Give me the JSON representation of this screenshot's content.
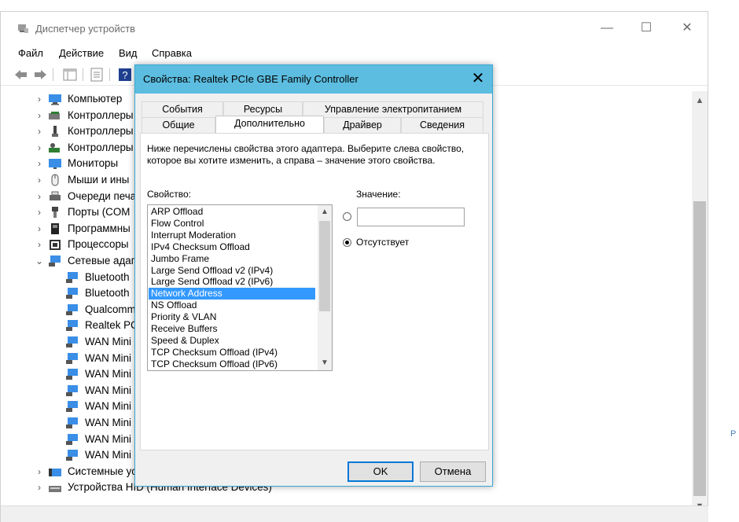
{
  "window": {
    "title": "Диспетчер устройств",
    "controls": {
      "minimize": "—",
      "maximize": "☐",
      "close": "✕"
    }
  },
  "menu": [
    "Файл",
    "Действие",
    "Вид",
    "Справка"
  ],
  "toolbar": {
    "icons": [
      "back-arrow-icon",
      "forward-arrow-icon",
      "console-tree-icon",
      "properties-icon",
      "help-icon"
    ]
  },
  "tree": {
    "top_rows": [
      {
        "label": "Компьютер",
        "icon": "computer-icon"
      },
      {
        "label": "Контроллеры",
        "icon": "ide-controller-icon"
      },
      {
        "label": "Контроллеры",
        "icon": "usb-controller-icon"
      },
      {
        "label": "Контроллеры",
        "icon": "storage-controller-icon"
      },
      {
        "label": "Мониторы",
        "icon": "monitor-icon"
      },
      {
        "label": "Мыши и ины",
        "icon": "mouse-icon"
      },
      {
        "label": "Очереди печа",
        "icon": "printer-icon"
      },
      {
        "label": "Порты (COM",
        "icon": "port-icon"
      },
      {
        "label": "Программны",
        "icon": "software-device-icon"
      },
      {
        "label": "Процессоры",
        "icon": "processor-icon"
      }
    ],
    "network_group": {
      "label": "Сетевые адап",
      "icon": "network-adapter-icon"
    },
    "adapters": [
      "Bluetooth",
      "Bluetooth",
      "Qualcomm",
      "Realtek PC",
      "WAN Mini",
      "WAN Mini",
      "WAN Mini",
      "WAN Mini",
      "WAN Mini",
      "WAN Mini",
      "WAN Mini",
      "WAN Mini"
    ],
    "bottom_rows": [
      {
        "label": "Системные ус",
        "icon": "system-device-icon"
      },
      {
        "label": "Устройства HID (Human Interface Devices)",
        "icon": "hid-device-icon"
      }
    ]
  },
  "side_text": "Р",
  "dialog": {
    "title": "Свойства: Realtek PCIe GBE Family Controller",
    "close_label": "✕",
    "tabs_back": [
      "События",
      "Ресурсы",
      "Управление электропитанием"
    ],
    "tabs_front": [
      "Общие",
      "Дополнительно",
      "Драйвер",
      "Сведения"
    ],
    "active_tab": "Дополнительно",
    "description": "Ниже перечислены свойства этого адаптера. Выберите слева свойство, которое вы хотите изменить, а справа – значение этого свойства.",
    "property_label": "Свойство:",
    "value_label": "Значение:",
    "properties": [
      "ARP Offload",
      "Flow Control",
      "Interrupt Moderation",
      "IPv4 Checksum Offload",
      "Jumbo Frame",
      "Large Send Offload v2 (IPv4)",
      "Large Send Offload v2 (IPv6)",
      "Network Address",
      "NS Offload",
      "Priority & VLAN",
      "Receive Buffers",
      "Speed & Duplex",
      "TCP Checksum Offload (IPv4)",
      "TCP Checksum Offload (IPv6)"
    ],
    "selected_property": "Network Address",
    "value_input": "",
    "absent_label": "Отсутствует",
    "absent_selected": true,
    "ok_label": "OK",
    "cancel_label": "Отмена"
  },
  "colors": {
    "dialog_title_bg": "#5cbde0",
    "selection": "#3399ff",
    "default_button_border": "#0078d7"
  }
}
